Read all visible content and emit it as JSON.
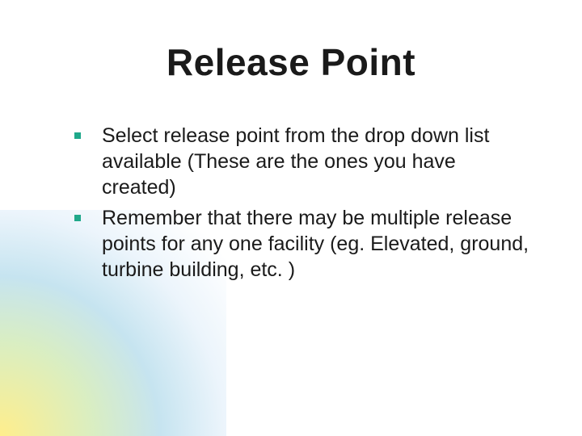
{
  "slide": {
    "title": "Release Point",
    "bullets": [
      "Select release point from the drop down list available (These are the ones you have created)",
      "Remember that there may be multiple release points for any one facility (eg. Elevated, ground, turbine building, etc. )"
    ]
  },
  "colors": {
    "bullet_square": "#1fa88a"
  }
}
